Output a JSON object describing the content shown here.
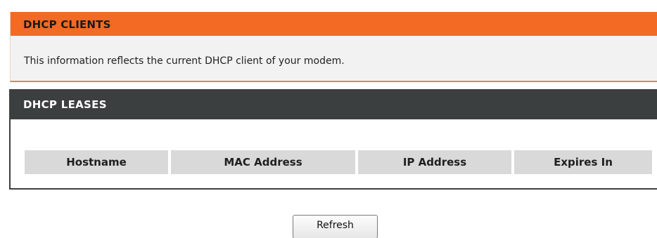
{
  "dhcp_clients": {
    "title": "DHCP CLIENTS",
    "description": "This information reflects the current DHCP client of your modem."
  },
  "dhcp_leases": {
    "title": "DHCP LEASES",
    "columns": [
      "Hostname",
      "MAC Address",
      "IP Address",
      "Expires In"
    ],
    "rows": []
  },
  "actions": {
    "refresh_label": "Refresh"
  },
  "colors": {
    "clients_header_bg": "#f26a24",
    "leases_header_bg": "#3b3f3f",
    "table_header_bg": "#d9d9d9",
    "panel_bg": "#f2f2f2"
  }
}
